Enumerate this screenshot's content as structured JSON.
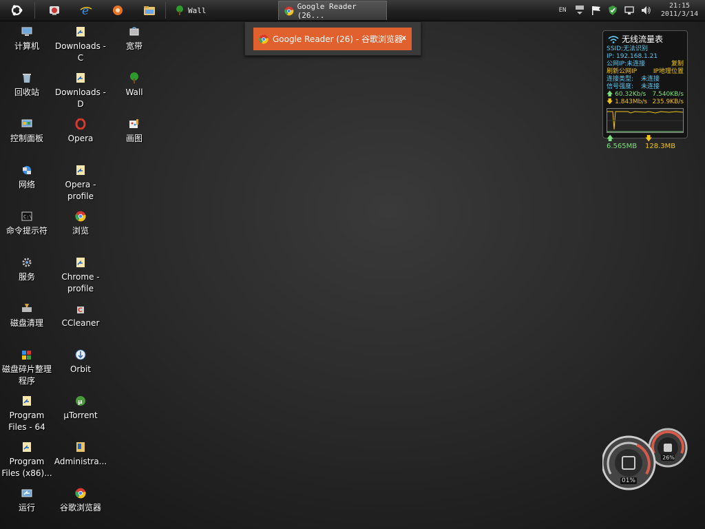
{
  "taskbar": {
    "tasks": [
      {
        "label": "Wall"
      },
      {
        "label": "Google Reader (26..."
      }
    ],
    "tray": {
      "lang": "EN",
      "time": "21:15",
      "date": "2011/3/14"
    }
  },
  "popup": {
    "label": "Google Reader (26) - 谷歌浏览器",
    "close": "x"
  },
  "desktop_icons": [
    {
      "label": "计算机",
      "icon": "computer-icon"
    },
    {
      "label": "Downloads - C",
      "icon": "shortcut-icon"
    },
    {
      "label": "宽带",
      "icon": "broadband-icon"
    },
    {
      "label": "回收站",
      "icon": "recycle-bin-icon"
    },
    {
      "label": "Downloads - D",
      "icon": "shortcut-icon"
    },
    {
      "label": "Wall",
      "icon": "tree-icon"
    },
    {
      "label": "控制面板",
      "icon": "control-panel-icon"
    },
    {
      "label": "Opera",
      "icon": "opera-icon"
    },
    {
      "label": "画图",
      "icon": "paint-icon"
    },
    {
      "label": "网络",
      "icon": "network-icon"
    },
    {
      "label": "Opera - profile",
      "icon": "shortcut-icon"
    },
    {
      "label": "命令提示符",
      "icon": "cmd-icon"
    },
    {
      "label": "浏览",
      "icon": "chrome-icon"
    },
    {
      "label": "服务",
      "icon": "services-icon"
    },
    {
      "label": "Chrome - profile",
      "icon": "shortcut-icon"
    },
    {
      "label": "磁盘清理",
      "icon": "disk-cleanup-icon"
    },
    {
      "label": "CCleaner",
      "icon": "ccleaner-icon"
    },
    {
      "label": "磁盘碎片整理程序",
      "icon": "defrag-icon"
    },
    {
      "label": "Orbit",
      "icon": "orbit-icon"
    },
    {
      "label": "Program Files - 64",
      "icon": "shortcut-icon"
    },
    {
      "label": "µTorrent",
      "icon": "utorrent-icon"
    },
    {
      "label": "Program Files (x86)...",
      "icon": "shortcut-icon"
    },
    {
      "label": "Administra...",
      "icon": "folder-shortcut-icon"
    },
    {
      "label": "运行",
      "icon": "run-icon"
    },
    {
      "label": "谷歌浏览器",
      "icon": "chrome-icon"
    }
  ],
  "widget": {
    "title": "无线流量表",
    "ssid": "SSID:无法识别",
    "ip": "IP: 192.168.1.21",
    "public_ip": "公网IP:未连接",
    "copy": "复制",
    "refresh": "刷新公网IP",
    "ip_location": "IP地理位置",
    "conn_type_label": "连接类型:",
    "conn_type_value": "未连接",
    "signal_label": "信号强度:",
    "signal_value": "未连接",
    "up_speed_1": "60.32Kb/s",
    "up_speed_2": "7.540KB/s",
    "down_speed_1": "1.843Mb/s",
    "down_speed_2": "235.9KB/s",
    "total_up": "6.565MB",
    "total_down": "128.3MB"
  },
  "gauges": {
    "cpu": "01%",
    "mem": "26%"
  },
  "colors": {
    "accent_orange": "#e0602e",
    "widget_cyan": "#5fc8f0",
    "widget_yellow": "#f2c419",
    "widget_green": "#7fe07f"
  }
}
